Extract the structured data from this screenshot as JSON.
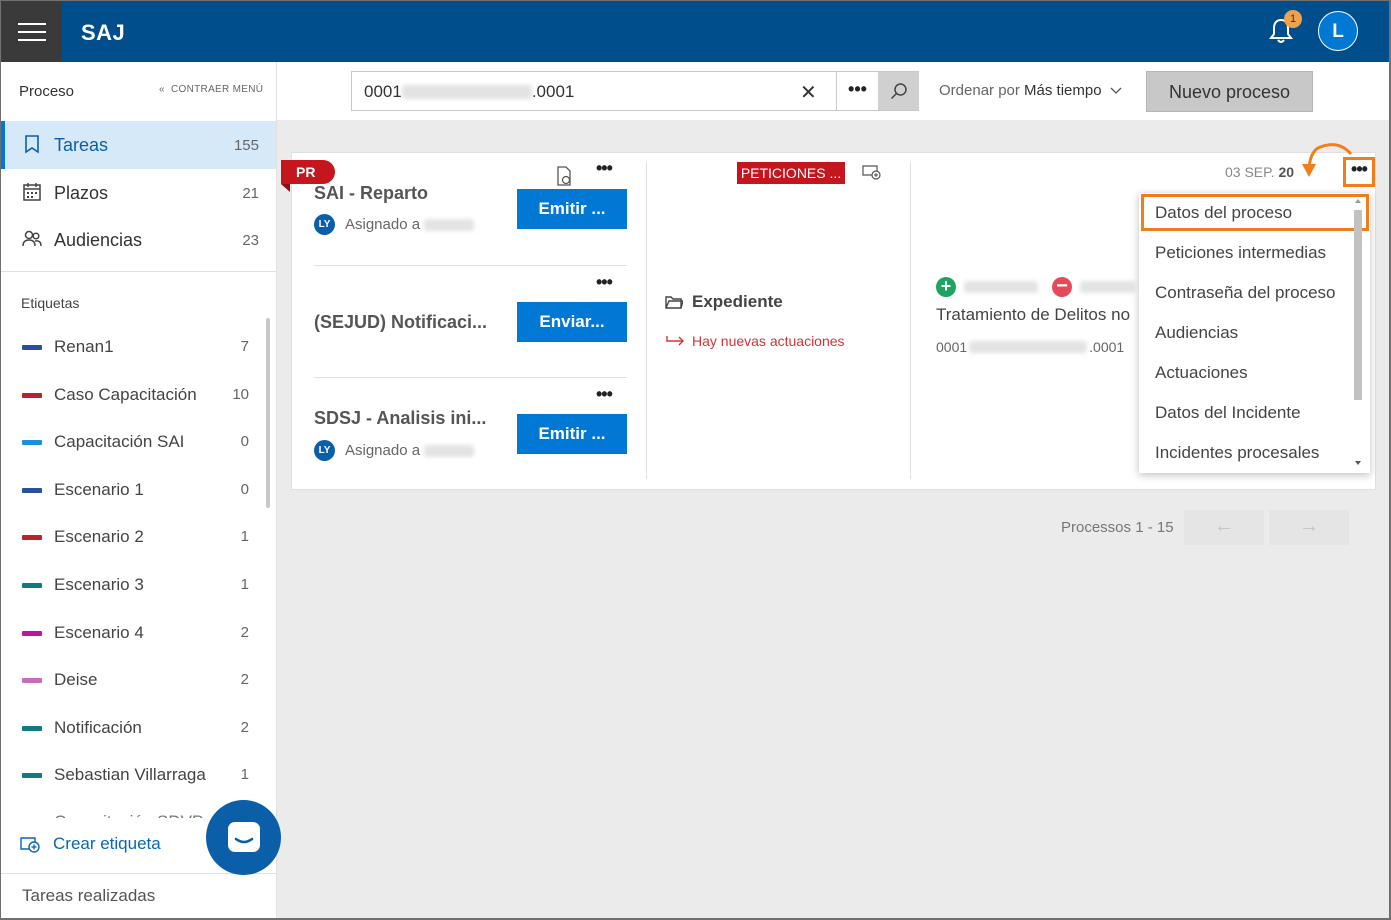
{
  "app": {
    "title": "SAJ",
    "notifications": "1",
    "user_initial": "L"
  },
  "sidebar": {
    "header": "Proceso",
    "collapse": "CONTRAER MENÚ",
    "main": [
      {
        "label": "Tareas",
        "count": "155",
        "icon": "tasks-icon"
      },
      {
        "label": "Plazos",
        "count": "21",
        "icon": "calendar-icon"
      },
      {
        "label": "Audiencias",
        "count": "23",
        "icon": "people-icon"
      }
    ],
    "tags_header": "Etiquetas",
    "tags": [
      {
        "label": "Renan1",
        "count": "7",
        "color": "#2b4ea0"
      },
      {
        "label": "Caso Capacitación",
        "count": "10",
        "color": "#b8232d"
      },
      {
        "label": "Capacitación SAI",
        "count": "0",
        "color": "#1e8fdc"
      },
      {
        "label": "Escenario 1",
        "count": "0",
        "color": "#2b4ea0"
      },
      {
        "label": "Escenario 2",
        "count": "1",
        "color": "#b8232d"
      },
      {
        "label": "Escenario 3",
        "count": "1",
        "color": "#0f7b80"
      },
      {
        "label": "Escenario 4",
        "count": "2",
        "color": "#b6179d"
      },
      {
        "label": "Deise",
        "count": "2",
        "color": "#c86bbd"
      },
      {
        "label": "Notificación",
        "count": "2",
        "color": "#0f7b80"
      },
      {
        "label": "Sebastian Villarraga",
        "count": "1",
        "color": "#0f7b80"
      }
    ],
    "partial_tag": "Capacitación SDVP",
    "create_tag": "Crear etiqueta",
    "done": "Tareas realizadas"
  },
  "toolbar": {
    "search_prefix": "0001",
    "search_suffix": ".0001",
    "sort_label": "Ordenar por",
    "sort_value": "Más tiempo",
    "new_process": "Nuevo proceso"
  },
  "card": {
    "badge": "PR",
    "tasks": [
      {
        "title": "SAI - Reparto",
        "button": "Emitir ...",
        "assigned": "Asignado a",
        "avatar": "LY"
      },
      {
        "title": "(SEJUD) Notificaci...",
        "button": "Enviar...",
        "assigned": "",
        "avatar": ""
      },
      {
        "title": "SDSJ - Analisis ini...",
        "button": "Emitir ...",
        "assigned": "Asignado a",
        "avatar": "LY"
      }
    ],
    "petitions_badge": "PETICIONES ...",
    "expediente": "Expediente",
    "news": "Hay nuevas actuaciones",
    "date": "03 SEP.",
    "date_day": "20",
    "treatment": "Tratamiento de Delitos no",
    "proc_prefix": "0001",
    "proc_suffix": ".0001"
  },
  "menu": {
    "items": [
      "Datos del proceso",
      "Peticiones intermedias",
      "Contraseña del proceso",
      "Audiencias",
      "Actuaciones",
      "Datos del Incidente",
      "Incidentes procesales"
    ],
    "highlight_color": "#f07f1b"
  },
  "pagination": {
    "text": "Processos 1 - 15",
    "prev": "←",
    "next": "→"
  }
}
